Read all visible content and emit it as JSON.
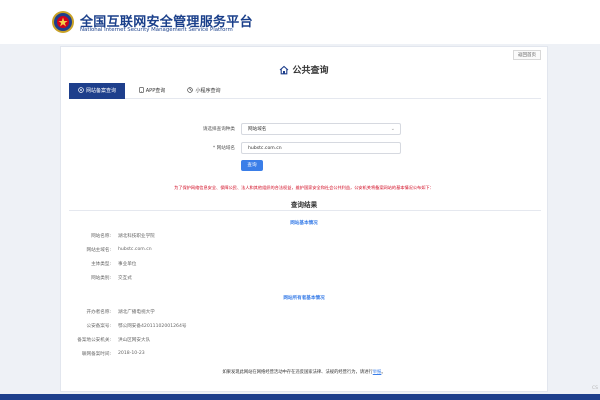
{
  "header": {
    "title": "全国互联网安全管理服务平台",
    "subtitle": "National Internet Security Management Service Platform",
    "emblem_icon": "police-emblem-icon"
  },
  "page": {
    "back_label": "返回首页",
    "title": "公共查询",
    "title_icon": "house-icon"
  },
  "tabs": [
    {
      "label": "网站备案查询",
      "icon": "target-icon",
      "active": true
    },
    {
      "label": "APP查询",
      "icon": "phone-icon",
      "active": false
    },
    {
      "label": "小程序查询",
      "icon": "mini-program-icon",
      "active": false
    }
  ],
  "form": {
    "type_label": "请选择查询种类",
    "type_value": "网站域名",
    "domain_label": "* 网站域名",
    "domain_value": "hubstc.com.cn",
    "query_label": "查询"
  },
  "notice": "为了保护网络信息安全、保障公民、法人和其他组织的合法权益，维护国家安全和社会公共利益，公安机关将备案网站的基本情况公布如下：",
  "results": {
    "title": "查询结果",
    "basic_section": "网站基本情况",
    "basic_rows": [
      {
        "label": "网站名称:",
        "value": "湖北科技职业学院"
      },
      {
        "label": "网站主域名:",
        "value": "hubstc.com.cn"
      },
      {
        "label": "主体类型:",
        "value": "事业单位"
      },
      {
        "label": "网站类别:",
        "value": "交互式"
      }
    ],
    "record_section": "网站所有者基本情况",
    "record_rows": [
      {
        "label": "开办者名称:",
        "value": "湖北广播电视大学"
      },
      {
        "label": "公安备案号:",
        "value": "鄂公网安备42011102001264号"
      },
      {
        "label": "备案地公安机关:",
        "value": "洪山区网安大队"
      },
      {
        "label": "联网备案时间:",
        "value": "2018-10-23"
      }
    ]
  },
  "footer": {
    "note": "如果发现此网站在网络经营活动中存在违反国家法律、法规的经营行为，请进行",
    "report_label": "举报",
    "note_end": "。"
  },
  "corner_text": "CS",
  "colors": {
    "brand": "#1e3f8c",
    "accent": "#3a7ee8",
    "notice": "#d0021b",
    "background": "#eef1f6"
  }
}
